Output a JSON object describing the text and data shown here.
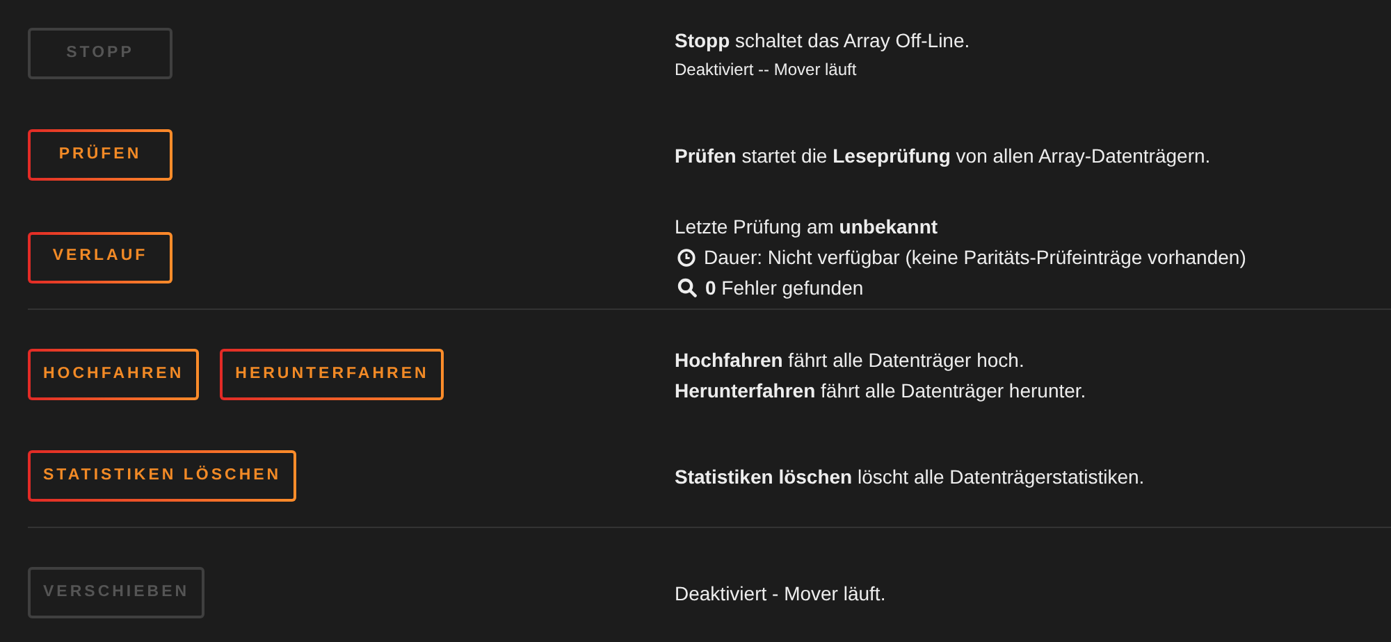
{
  "sections": [
    {
      "rows": [
        {
          "buttons": [
            {
              "label": "STOPP",
              "disabled": true
            }
          ],
          "lines": [
            {
              "text": "**Stopp** schaltet das Array Off-Line.",
              "kind": "normal"
            },
            {
              "text": "Deaktiviert -- Mover läuft",
              "kind": "small"
            }
          ]
        },
        {
          "buttons": [
            {
              "label": "PRÜFEN",
              "disabled": false
            }
          ],
          "lines": [
            {
              "text": "**Prüfen** startet die **Leseprüfung** von allen Array-Datenträgern.",
              "kind": "normal"
            }
          ]
        },
        {
          "buttons": [
            {
              "label": "VERLAUF",
              "disabled": false
            }
          ],
          "lines": [
            {
              "text": "Letzte Prüfung am **unbekannt**",
              "kind": "normal"
            },
            {
              "text": "Dauer: Nicht verfügbar (keine Paritäts-Prüfeinträge vorhanden)",
              "kind": "clock"
            },
            {
              "text": "**0** Fehler gefunden",
              "kind": "search"
            }
          ]
        }
      ]
    },
    {
      "rows": [
        {
          "buttons": [
            {
              "label": "HOCHFAHREN",
              "disabled": false
            },
            {
              "label": "HERUNTERFAHREN",
              "disabled": false
            }
          ],
          "lines": [
            {
              "text": "**Hochfahren** fährt alle Datenträger hoch.",
              "kind": "normal"
            },
            {
              "text": "**Herunterfahren** fährt alle Datenträger herunter.",
              "kind": "normal"
            }
          ]
        },
        {
          "buttons": [
            {
              "label": "STATISTIKEN LÖSCHEN",
              "disabled": false
            }
          ],
          "lines": [
            {
              "text": "**Statistiken löschen** löscht alle Datenträgerstatistiken.",
              "kind": "normal"
            }
          ]
        }
      ]
    },
    {
      "rows": [
        {
          "buttons": [
            {
              "label": "VERSCHIEBEN",
              "disabled": true
            }
          ],
          "lines": [
            {
              "text": "Deaktiviert - Mover läuft.",
              "kind": "normal"
            }
          ]
        }
      ]
    }
  ]
}
